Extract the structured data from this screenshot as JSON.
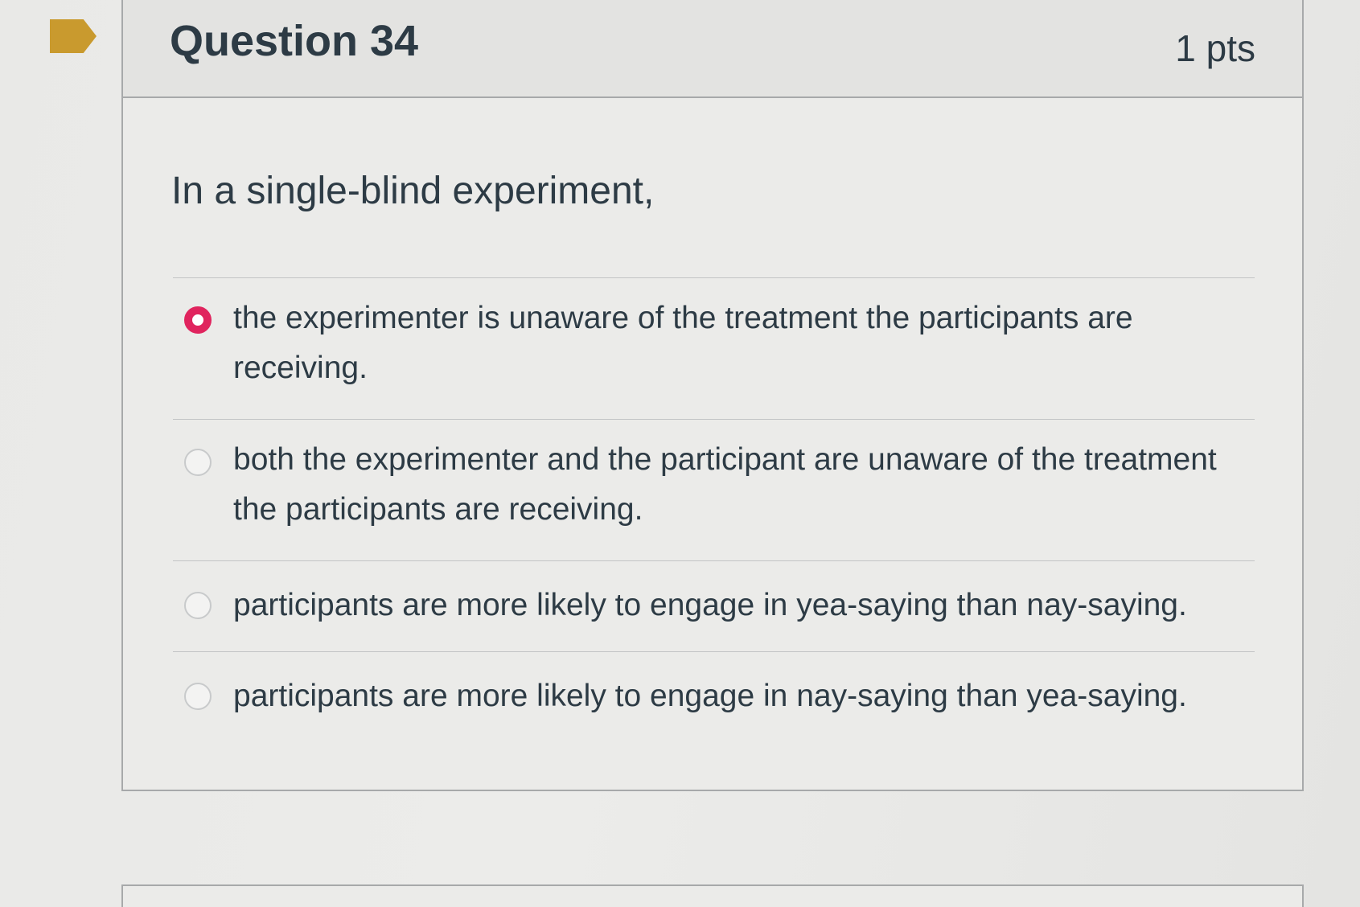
{
  "question": {
    "title": "Question 34",
    "points": "1 pts",
    "prompt": "In a single-blind experiment,",
    "flag_color": "#c99a2e",
    "selected_color": "#e0245e",
    "answers": [
      {
        "label": "the experimenter is unaware of the treatment the participants are receiving.",
        "selected": true
      },
      {
        "label": "both the experimenter and the participant are unaware of the treatment the participants are receiving.",
        "selected": false
      },
      {
        "label": "participants are more likely to engage in yea-saying than nay-saying.",
        "selected": false
      },
      {
        "label": "participants are more likely to engage in nay-saying than yea-saying.",
        "selected": false
      }
    ]
  }
}
